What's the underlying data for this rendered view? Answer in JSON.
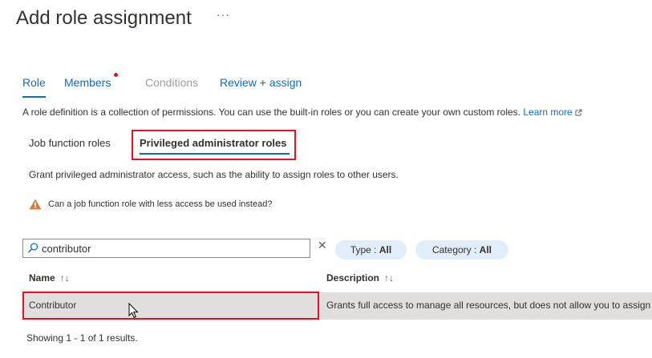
{
  "header": {
    "title": "Add role assignment",
    "more_label": "···"
  },
  "tabs": [
    {
      "label": "Role",
      "state": "selected"
    },
    {
      "label": "Members",
      "state": "has-indicator"
    },
    {
      "label": "Conditions",
      "state": "disabled"
    },
    {
      "label": "Review + assign",
      "state": "default"
    }
  ],
  "description": {
    "text": "A role definition is a collection of permissions. You can use the built-in roles or you can create your own custom roles.",
    "link": "Learn more"
  },
  "role_tabs": [
    {
      "label": "Job function roles"
    },
    {
      "label": "Privileged administrator roles",
      "selected": true
    }
  ],
  "grant_text": "Grant privileged administrator access, such as the ability to assign roles to other users.",
  "warning_text": "Can a job function role with less access be used instead?",
  "search": {
    "value": "contributor",
    "placeholder": ""
  },
  "filters": [
    {
      "label": "Type : ",
      "value": "All"
    },
    {
      "label": "Category : ",
      "value": "All"
    }
  ],
  "table": {
    "columns": [
      {
        "label": "Name",
        "sort": "↑↓"
      },
      {
        "label": "Description",
        "sort": "↑↓"
      }
    ],
    "rows": [
      {
        "name": "Contributor",
        "description": "Grants full access to manage all resources, but does not allow you to assign roles in Azure RBAC"
      }
    ]
  },
  "footer": "Showing 1 - 1 of 1 results.",
  "colors": {
    "accent": "#0f6cbd",
    "highlight": "#e81123",
    "warning": "#d67f3c",
    "pill": "#e1edf9",
    "row_selected": "#e1dfdd"
  },
  "icons": [
    "more-icon",
    "external-link-icon",
    "warning-icon",
    "search-icon",
    "clear-icon",
    "mouse-cursor-icon"
  ]
}
